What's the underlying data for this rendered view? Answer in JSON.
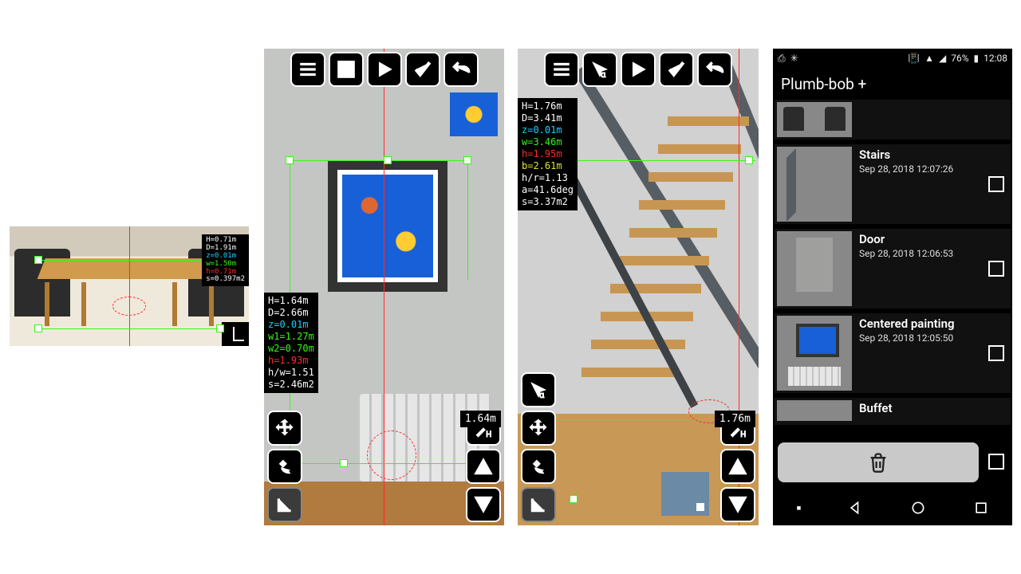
{
  "screen0": {
    "meas": [
      {
        "cls": "m-white",
        "t": "H=0.71m"
      },
      {
        "cls": "m-white",
        "t": "D=1.91m"
      },
      {
        "cls": "m-blue",
        "t": "z=0.01m"
      },
      {
        "cls": "m-green",
        "t": "w=1.50m"
      },
      {
        "cls": "m-red",
        "t": "h=0.71m"
      },
      {
        "cls": "m-white",
        "t": "s=0.397m2"
      }
    ]
  },
  "screen1": {
    "meas": [
      {
        "cls": "m-white",
        "t": "H=1.64m"
      },
      {
        "cls": "m-white",
        "t": "D=2.66m"
      },
      {
        "cls": "m-blue",
        "t": "z=0.01m"
      },
      {
        "cls": "m-green",
        "t": "w1=1.27m"
      },
      {
        "cls": "m-green",
        "t": "w2=0.70m"
      },
      {
        "cls": "m-red",
        "t": "h=1.93m"
      },
      {
        "cls": "m-white",
        "t": "h/w=1.51"
      },
      {
        "cls": "m-white",
        "t": "s=2.46m2"
      }
    ],
    "distance": "1.64m"
  },
  "screen2": {
    "meas": [
      {
        "cls": "m-white",
        "t": "H=1.76m"
      },
      {
        "cls": "m-white",
        "t": "D=3.41m"
      },
      {
        "cls": "m-blue",
        "t": "z=0.01m"
      },
      {
        "cls": "m-green",
        "t": "w=3.46m"
      },
      {
        "cls": "m-red",
        "t": "h=1.95m"
      },
      {
        "cls": "m-yellow",
        "t": "b=2.61m"
      },
      {
        "cls": "m-white",
        "t": "h/r=1.13"
      },
      {
        "cls": "m-white",
        "t": "a=41.6deg"
      },
      {
        "cls": "m-white",
        "t": "s=3.37m2"
      }
    ],
    "distance": "1.76m"
  },
  "screen3": {
    "status": {
      "battery": "76%",
      "time": "12:08"
    },
    "title": "Plumb-bob +",
    "items": [
      {
        "name": "",
        "date": ""
      },
      {
        "name": "Stairs",
        "date": "Sep 28, 2018 12:07:26"
      },
      {
        "name": "Door",
        "date": "Sep 28, 2018 12:06:53"
      },
      {
        "name": "Centered painting",
        "date": "Sep 28, 2018 12:05:50"
      },
      {
        "name": "Buffet",
        "date": ""
      }
    ]
  }
}
